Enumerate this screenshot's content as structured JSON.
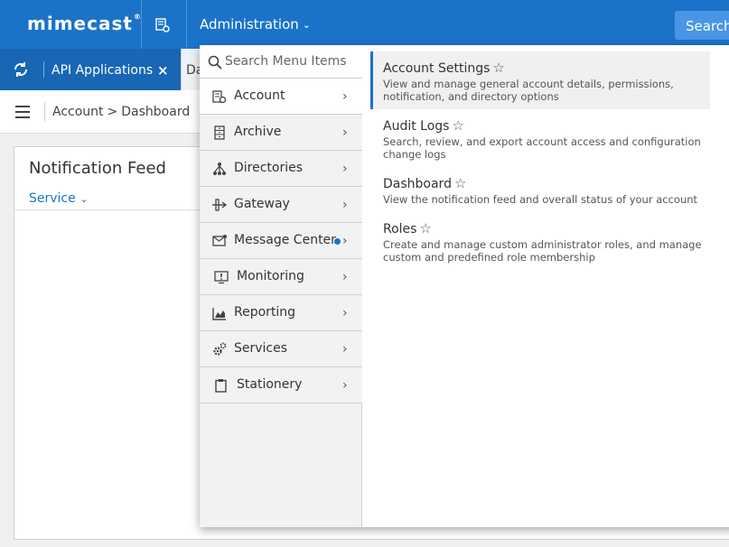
{
  "topbar": {
    "logo": "mimecast",
    "logo_mark": "®",
    "admin_label": "Administration",
    "search_label": "Search"
  },
  "tabs": {
    "active_label": "API Applications",
    "close_glyph": "×",
    "next_label_partial": "Da"
  },
  "breadcrumb": {
    "root": "Account",
    "separator": ">",
    "current": "Dashboard"
  },
  "card": {
    "title": "Notification Feed",
    "filter_label": "Service"
  },
  "menu": {
    "search_placeholder": "Search Menu Items",
    "items": [
      {
        "label": "Account",
        "icon": "account-settings-icon",
        "active": true
      },
      {
        "label": "Archive",
        "icon": "archive-icon"
      },
      {
        "label": "Directories",
        "icon": "directories-icon"
      },
      {
        "label": "Gateway",
        "icon": "gateway-icon"
      },
      {
        "label": "Message Center",
        "icon": "message-center-icon",
        "badge": true
      },
      {
        "label": "Monitoring",
        "icon": "monitoring-icon"
      },
      {
        "label": "Reporting",
        "icon": "reporting-icon"
      },
      {
        "label": "Services",
        "icon": "services-icon"
      },
      {
        "label": "Stationery",
        "icon": "stationery-icon"
      }
    ],
    "chevron": "›"
  },
  "submenu": [
    {
      "title": "Account Settings",
      "desc": "View and manage general account details, permissions, notification, and directory options",
      "selected": true
    },
    {
      "title": "Audit Logs",
      "desc": "Search, review, and export account access and configuration change logs"
    },
    {
      "title": "Dashboard",
      "desc": "View the notification feed and overall status of your account"
    },
    {
      "title": "Roles",
      "desc": "Create and manage custom administrator roles, and manage custom and predefined role membership"
    }
  ],
  "colors": {
    "brand": "#1b73c9",
    "search_button": "#4a95e5"
  }
}
